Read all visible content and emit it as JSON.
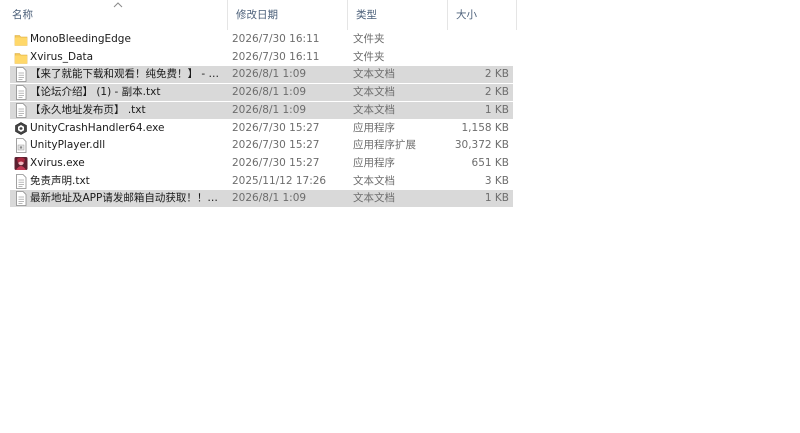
{
  "columns": {
    "name": "名称",
    "modified": "修改日期",
    "type": "类型",
    "size": "大小"
  },
  "files": [
    {
      "icon": "folder-icon",
      "name": "MonoBleedingEdge",
      "modified": "2026/7/30 16:11",
      "type": "文件夹",
      "size": "",
      "selected": false
    },
    {
      "icon": "folder-icon",
      "name": "Xvirus_Data",
      "modified": "2026/7/30 16:11",
      "type": "文件夹",
      "size": "",
      "selected": false
    },
    {
      "icon": "text-file-icon",
      "name": "【来了就能下载和观看！纯免费！】 - 副...",
      "modified": "2026/8/1 1:09",
      "type": "文本文档",
      "size": "2 KB",
      "selected": true
    },
    {
      "icon": "text-file-icon",
      "name": "【论坛介绍】 (1) - 副本.txt",
      "modified": "2026/8/1 1:09",
      "type": "文本文档",
      "size": "2 KB",
      "selected": true
    },
    {
      "icon": "text-file-icon",
      "name": "【永久地址发布页】 .txt",
      "modified": "2026/8/1 1:09",
      "type": "文本文档",
      "size": "1 KB",
      "selected": true
    },
    {
      "icon": "unity-app-icon",
      "name": "UnityCrashHandler64.exe",
      "modified": "2026/7/30 15:27",
      "type": "应用程序",
      "size": "1,158 KB",
      "selected": false
    },
    {
      "icon": "dll-file-icon",
      "name": "UnityPlayer.dll",
      "modified": "2026/7/30 15:27",
      "type": "应用程序扩展",
      "size": "30,372 KB",
      "selected": false
    },
    {
      "icon": "game-app-icon",
      "name": "Xvirus.exe",
      "modified": "2026/7/30 15:27",
      "type": "应用程序",
      "size": "651 KB",
      "selected": false
    },
    {
      "icon": "text-file-icon",
      "name": "免责声明.txt",
      "modified": "2025/11/12 17:26",
      "type": "文本文档",
      "size": "3 KB",
      "selected": false
    },
    {
      "icon": "text-file-icon",
      "name": "最新地址及APP请发邮箱自动获取！！！...",
      "modified": "2026/8/1 1:09",
      "type": "文本文档",
      "size": "1 KB",
      "selected": true
    }
  ]
}
